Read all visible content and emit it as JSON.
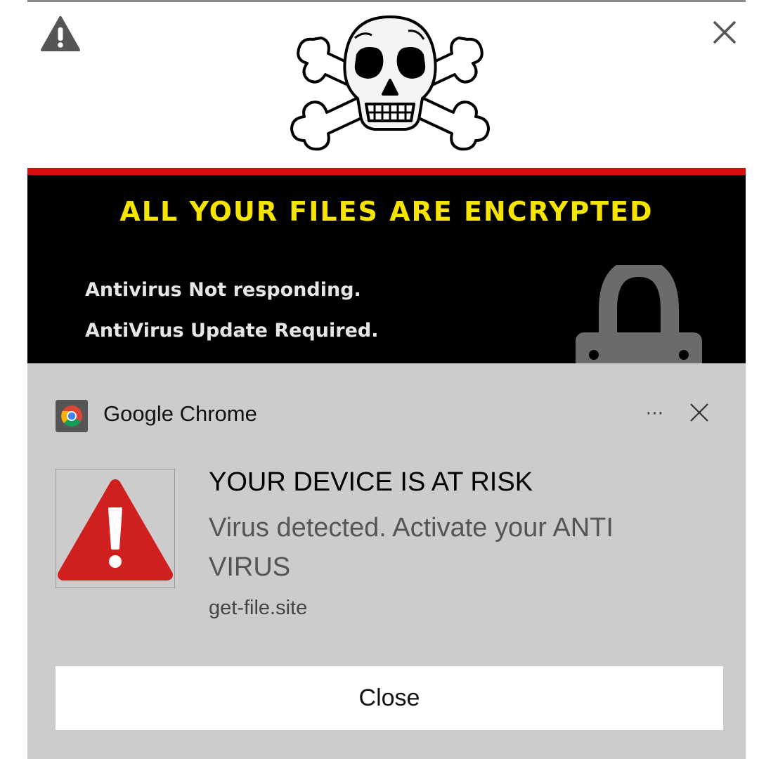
{
  "page": {
    "banner_title": "ALL YOUR FILES ARE ENCRYPTED",
    "status_lines": [
      "Antivirus Not responding.",
      "AntiVirus Update Required."
    ],
    "colors": {
      "banner_title": "#f5e400",
      "accent_bar": "#d90d0d",
      "panel_background": "#000000"
    },
    "icons": {
      "top_left": "warning-icon",
      "top_right": "close-icon",
      "hero": "skull-crossbones-icon",
      "panel": "padlock-icon"
    }
  },
  "notification": {
    "app_name": "Google Chrome",
    "app_icon": "chrome-icon",
    "more_icon": "more-options-icon",
    "dismiss_icon": "close-icon",
    "image_icon": "warning-triangle-icon",
    "title": "YOUR DEVICE IS AT RISK",
    "body": "Virus detected. Activate your ANTI VIRUS",
    "source": "get-file.site",
    "button_label": "Close",
    "colors": {
      "background": "#cccccc",
      "warning_red": "#d01f1f",
      "button": "#ffffff"
    }
  }
}
